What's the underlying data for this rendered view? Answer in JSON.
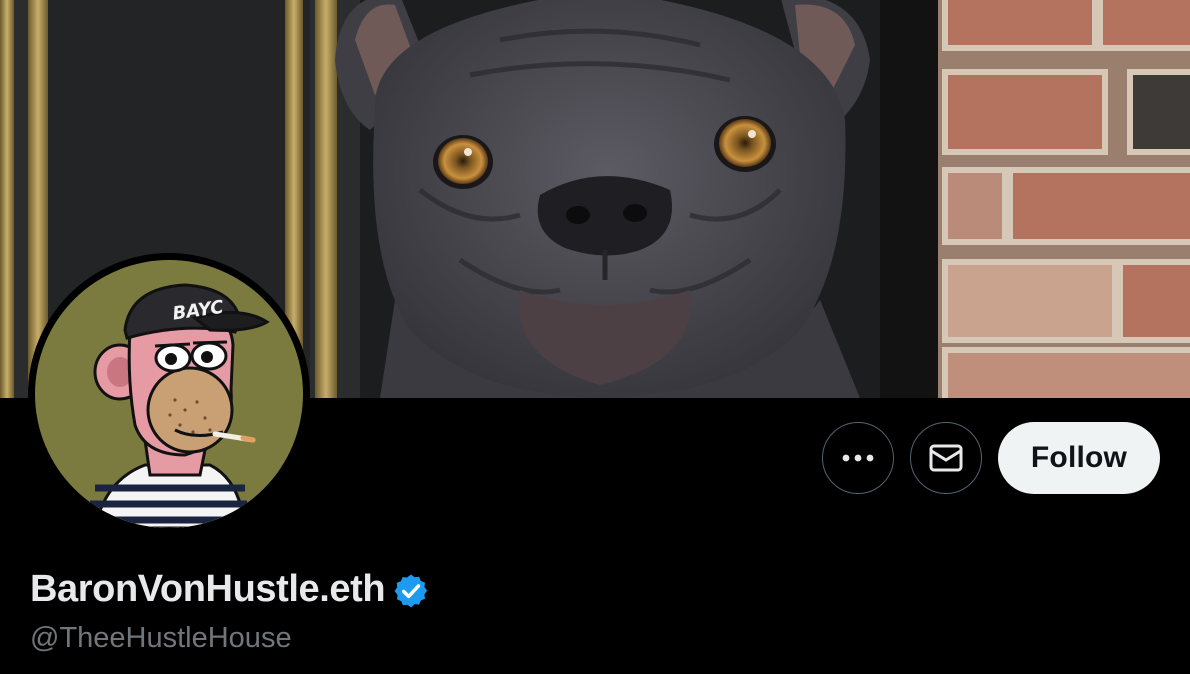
{
  "profile": {
    "display_name": "BaronVonHustle.eth",
    "handle": "@TheeHustleHouse",
    "verified": true,
    "verified_color": "#1d9bf0",
    "avatar_hat_text": "BAYC"
  },
  "actions": {
    "more_icon": "more-horizontal-icon",
    "message_icon": "envelope-icon",
    "follow_label": "Follow"
  },
  "colors": {
    "background": "#000000",
    "follow_button_bg": "#eff3f4",
    "follow_button_text": "#0f1419",
    "handle_text": "#71767b",
    "primary_text": "#e7e9ea",
    "outline": "#536471"
  }
}
